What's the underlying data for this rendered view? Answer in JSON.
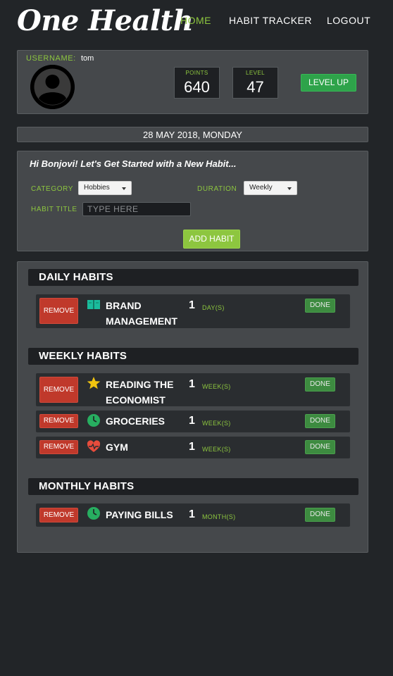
{
  "nav": {
    "logo": "One Health",
    "links": [
      "HOME",
      "HABIT TRACKER",
      "LOGOUT"
    ]
  },
  "profile": {
    "username_label": "USERNAME:",
    "username": "tom",
    "points_label": "POINTS",
    "points": "640",
    "level_label": "LEVEL",
    "level": "47",
    "level_up": "LEVEL UP",
    "avatar_icon": "user-avatar-icon"
  },
  "date": "28 MAY 2018, MONDAY",
  "form": {
    "greeting": "Hi Bonjovi! Let's Get Started with a New Habit...",
    "category_label": "CATEGORY",
    "category_value": "Hobbies",
    "duration_label": "DURATION",
    "duration_value": "Weekly",
    "title_label": "HABIT TITLE",
    "title_placeholder": "TYPE HERE",
    "add_button": "ADD HABIT"
  },
  "sections": {
    "daily": {
      "title": "DAILY HABITS",
      "items": [
        {
          "remove": "REMOVE",
          "icon": "book-icon",
          "name": "BRAND MANAGEMENT",
          "count": "1",
          "unit": "DAY(S)",
          "done": "DONE"
        }
      ]
    },
    "weekly": {
      "title": "WEEKLY HABITS",
      "items": [
        {
          "remove": "REMOVE",
          "icon": "star-icon",
          "name": "READING THE ECONOMIST",
          "count": "1",
          "unit": "WEEK(S)",
          "done": "DONE"
        },
        {
          "remove": "REMOVE",
          "icon": "clock-icon",
          "name": "GROCERIES",
          "count": "1",
          "unit": "WEEK(S)",
          "done": "DONE"
        },
        {
          "remove": "REMOVE",
          "icon": "heart-icon",
          "name": "GYM",
          "count": "1",
          "unit": "WEEK(S)",
          "done": "DONE"
        }
      ]
    },
    "monthly": {
      "title": "MONTHLY HABITS",
      "items": [
        {
          "remove": "REMOVE",
          "icon": "clock-icon",
          "name": "PAYING BILLS",
          "count": "1",
          "unit": "MONTH(S)",
          "done": "DONE"
        }
      ]
    }
  },
  "colors": {
    "accent": "#8dc63f",
    "background": "#222528",
    "panel": "#45484b",
    "remove": "#c0392b",
    "done": "#3d8b40",
    "level_up": "#2ea34a"
  }
}
